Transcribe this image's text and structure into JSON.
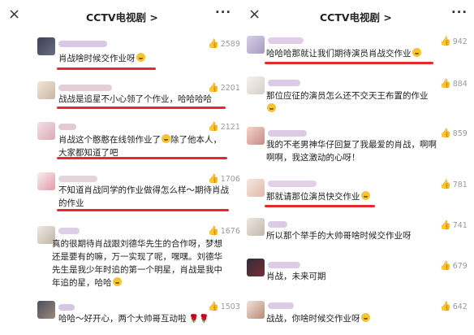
{
  "left": {
    "title": "CCTV电视剧 >",
    "comments": [
      {
        "likes": "2589",
        "text": "肖战啥时候交作业呀"
      },
      {
        "likes": "2201",
        "text": "战战是追星不小心领了个作业，哈哈哈哈"
      },
      {
        "likes": "2121",
        "text_lines": [
          "肖战这个憨憨在线领作业了",
          "除了他本人，",
          "大家都知道了吧"
        ]
      },
      {
        "likes": "1706",
        "text_lines": [
          "不知道肖战同学的作业做得怎么样～期待肖战",
          "的作业"
        ]
      },
      {
        "likes": "1676",
        "text_lines": [
          "真的很期待肖战跟刘德华先生的合作呀，梦想",
          "还是要有的嘛，万一实现了呢，嘿嘿。刘德华",
          "先生是我少年时追的第一个明星，肖战是我中",
          "年追的星，哈哈"
        ]
      },
      {
        "likes": "1503",
        "text": "哈哈～好开心，两个大帅哥互动啦"
      }
    ]
  },
  "right": {
    "title": "CCTV电视剧 >",
    "comments": [
      {
        "likes": "942",
        "text": "哈哈哈那就让我们期待演员肖战交作业"
      },
      {
        "likes": "884",
        "text": "那位应征的演员怎么还不交天王布置的作业"
      },
      {
        "likes": "859",
        "text_lines": [
          "我的不老男神华仔回复了我最爱的肖战，啊啊",
          "啊啊，我这激动的心呀！"
        ]
      },
      {
        "likes": "781",
        "text": "那就请那位演员快交作业"
      },
      {
        "likes": "741",
        "text": "所以那个举手的大帅哥啥时候交作业呀"
      },
      {
        "likes": "679",
        "text": "肖战，未来可期"
      },
      {
        "likes": "642",
        "text": "战战，你啥时候交作业呀"
      }
    ]
  },
  "icons": {
    "close": "×",
    "more": "···",
    "thumb": "👍"
  },
  "colors": {
    "underline": "#e5292e",
    "like_text": "#9a9a9a",
    "thumb": "#6a8fd0"
  }
}
